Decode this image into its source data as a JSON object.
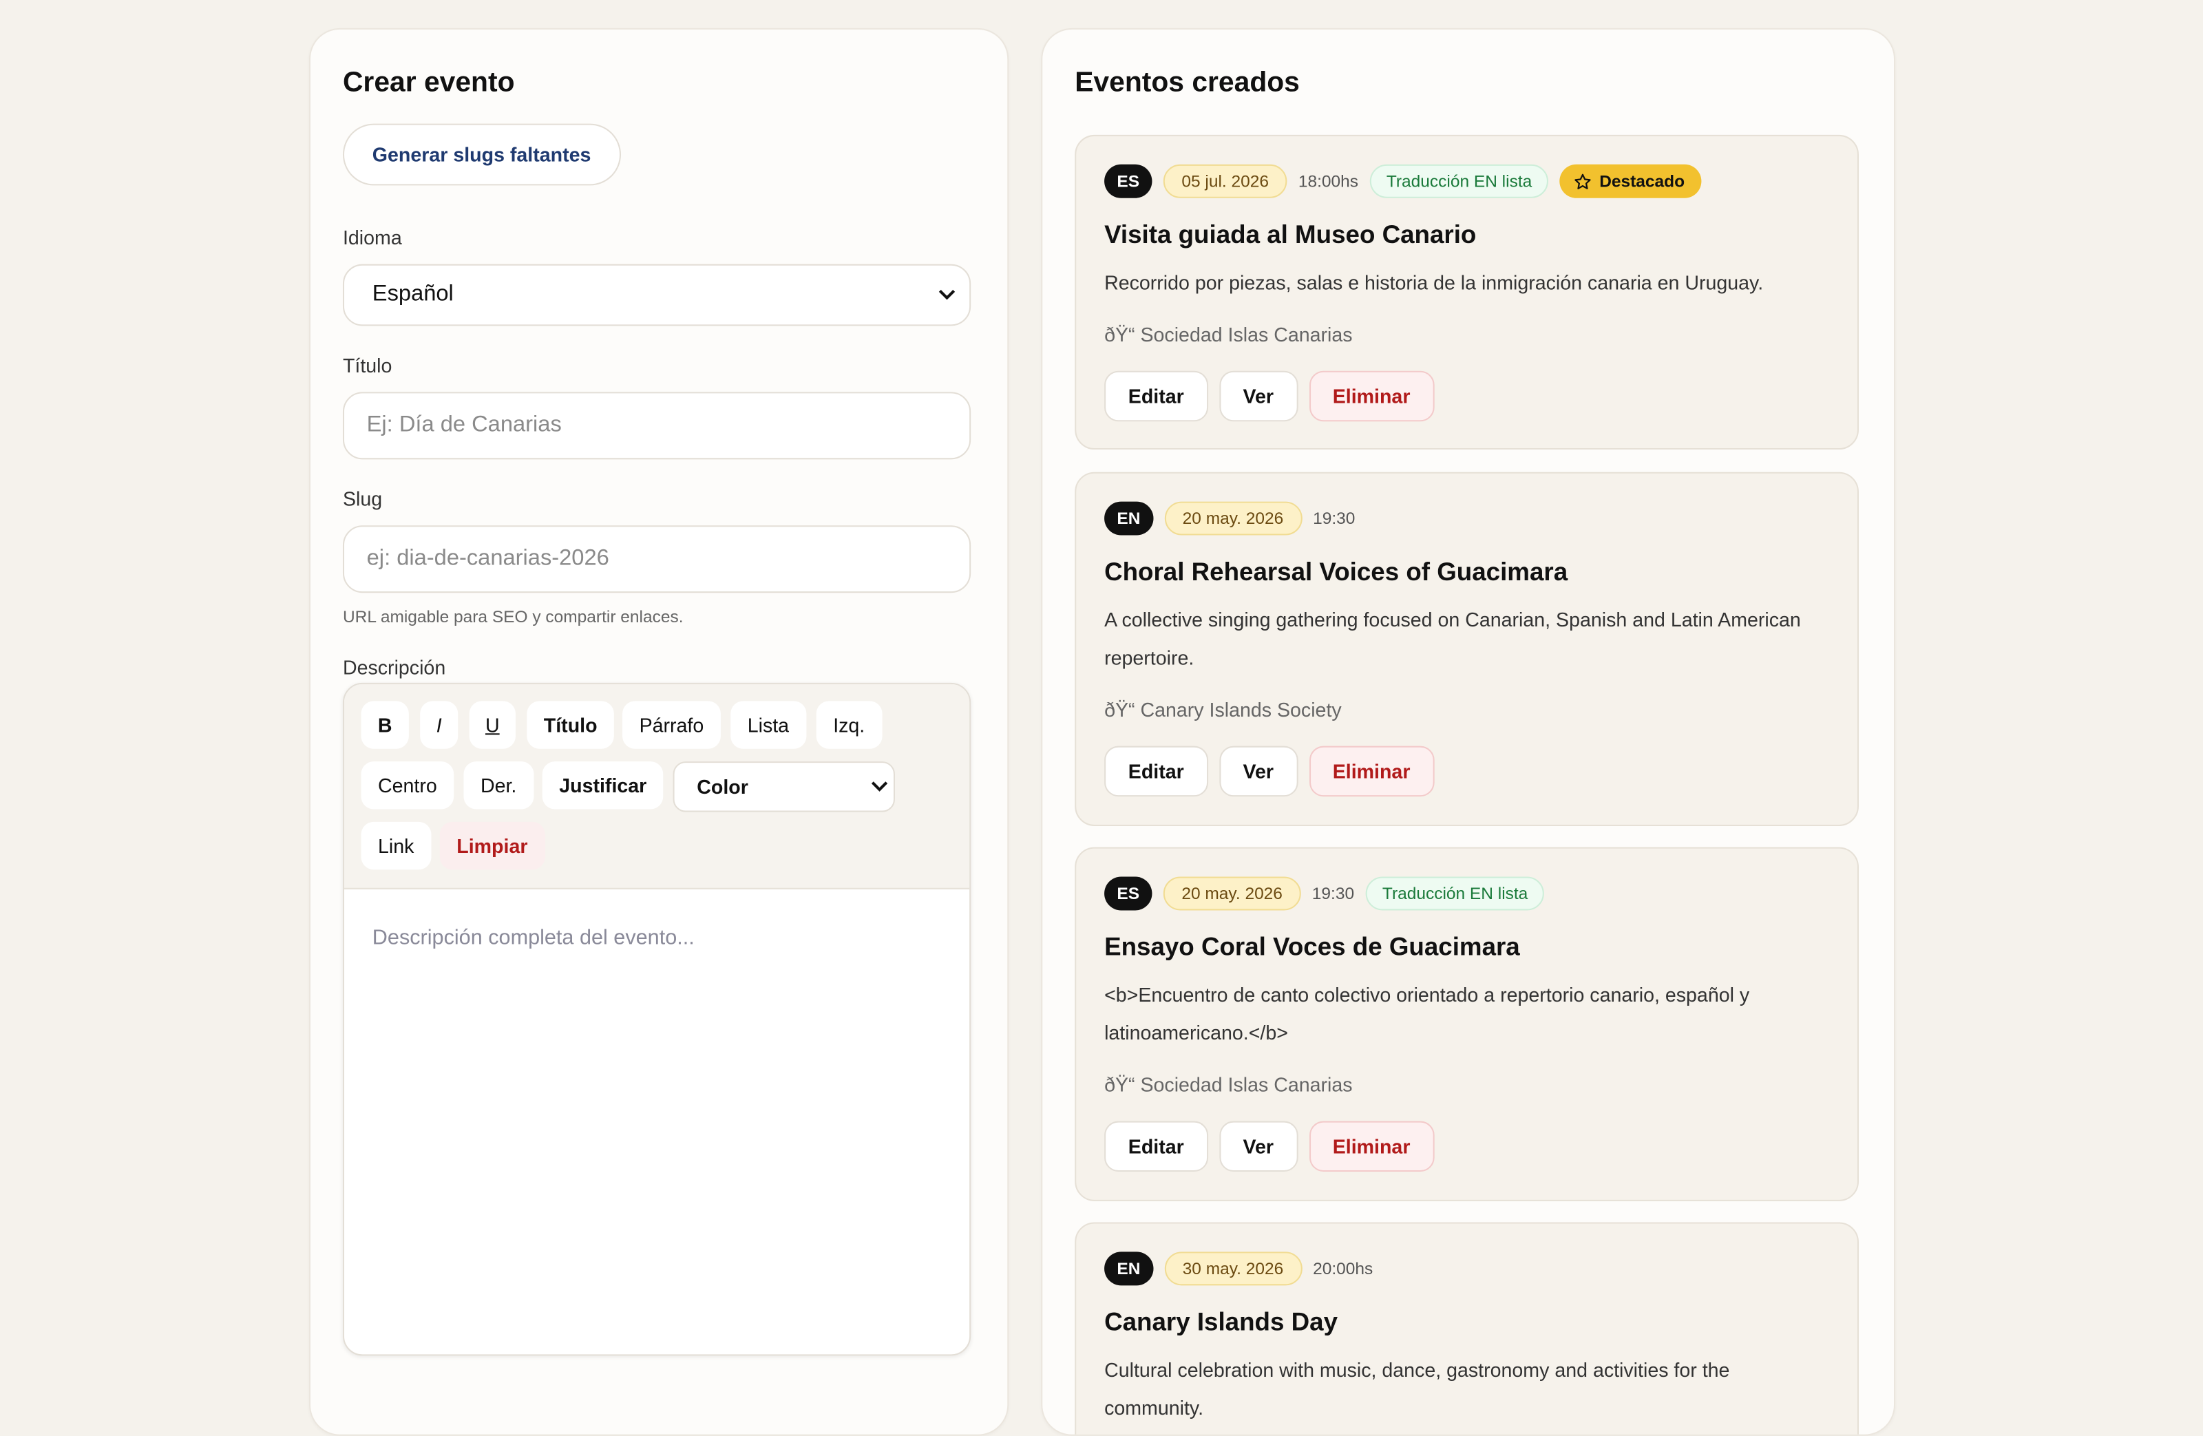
{
  "form": {
    "heading": "Crear evento",
    "slugs_button": "Generar slugs faltantes",
    "language_label": "Idioma",
    "language_value": "Español",
    "title_label": "Título",
    "title_placeholder": "Ej: Día de Canarias",
    "slug_label": "Slug",
    "slug_placeholder": "ej: dia-de-canarias-2026",
    "slug_hint": "URL amigable para SEO y compartir enlaces.",
    "description_label": "Descripción",
    "toolbar": {
      "bold": "B",
      "italic": "I",
      "underline": "U",
      "heading": "Título",
      "paragraph": "Párrafo",
      "list": "Lista",
      "left": "Izq.",
      "center": "Centro",
      "right": "Der.",
      "justify": "Justificar",
      "color": "Color",
      "link": "Link",
      "clear": "Limpiar"
    },
    "description_placeholder": "Descripción completa del evento..."
  },
  "events": {
    "heading": "Eventos creados",
    "actions": {
      "edit": "Editar",
      "view": "Ver",
      "delete": "Eliminar"
    },
    "items": [
      {
        "lang": "ES",
        "date": "05 jul. 2026",
        "time": "18:00hs",
        "translation": "Traducción EN lista",
        "featured": "Destacado",
        "title": "Visita guiada al Museo Canario",
        "description": "Recorrido por piezas, salas e historia de la inmigración canaria en Uruguay.",
        "organizer": "ðŸ“ Sociedad Islas Canarias"
      },
      {
        "lang": "EN",
        "date": "20 may. 2026",
        "time": "19:30",
        "title": "Choral Rehearsal Voices of Guacimara",
        "description": "A collective singing gathering focused on Canarian, Spanish and Latin American repertoire.",
        "organizer": "ðŸ“ Canary Islands Society"
      },
      {
        "lang": "ES",
        "date": "20 may. 2026",
        "time": "19:30",
        "translation": "Traducción EN lista",
        "title": "Ensayo Coral Voces de Guacimara",
        "description": "<b>Encuentro de canto colectivo orientado a repertorio canario, español y latinoamericano.</b>",
        "organizer": "ðŸ“ Sociedad Islas Canarias"
      },
      {
        "lang": "EN",
        "date": "30 may. 2026",
        "time": "20:00hs",
        "title": "Canary Islands Day",
        "description": "Cultural celebration with music, dance, gastronomy and activities for the community."
      }
    ]
  }
}
